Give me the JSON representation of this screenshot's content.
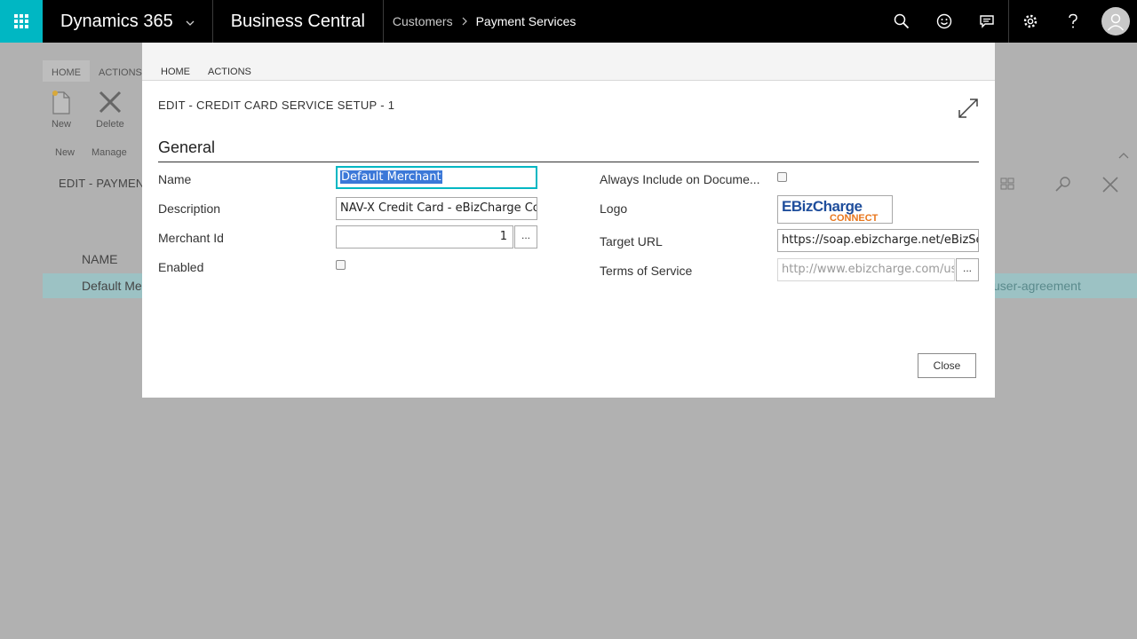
{
  "topbar": {
    "brand": "Dynamics 365",
    "product": "Business Central",
    "breadcrumb": [
      "Customers",
      "Payment Services"
    ]
  },
  "background": {
    "tabs": [
      "HOME",
      "ACTIONS"
    ],
    "actions": [
      "New",
      "Delete"
    ],
    "groups": [
      "New",
      "Manage"
    ],
    "page_title": "EDIT - PAYMENT",
    "column_header": "NAME",
    "row_name": "Default Me",
    "row_tail": "user-agreement"
  },
  "modal": {
    "tabs": [
      "HOME",
      "ACTIONS"
    ],
    "title": "EDIT - CREDIT CARD SERVICE SETUP - 1",
    "section": "General",
    "left": {
      "name_label": "Name",
      "name_value": "Default Merchant",
      "description_label": "Description",
      "description_value": "NAV-X Credit Card - eBizCharge Connect",
      "merchant_label": "Merchant Id",
      "merchant_value": "1",
      "enabled_label": "Enabled",
      "enabled": false
    },
    "right": {
      "always_label": "Always Include on Docume...",
      "always": false,
      "logo_label": "Logo",
      "logo_text_top": "EBizCharge",
      "logo_text_bottom": "CONNECT",
      "target_label": "Target URL",
      "target_value": "https://soap.ebizcharge.net/eBizService.svc",
      "terms_label": "Terms of Service",
      "terms_value": "http://www.ebizcharge.com/user-agreement"
    },
    "lookup_glyph": "...",
    "close_label": "Close"
  },
  "colors": {
    "accent": "#00b7c3",
    "topbar": "#000000",
    "overlay": "#b1b1b1",
    "selection": "#3b78d8",
    "logo_blue": "#1f4e9c",
    "logo_orange": "#e8761c"
  }
}
